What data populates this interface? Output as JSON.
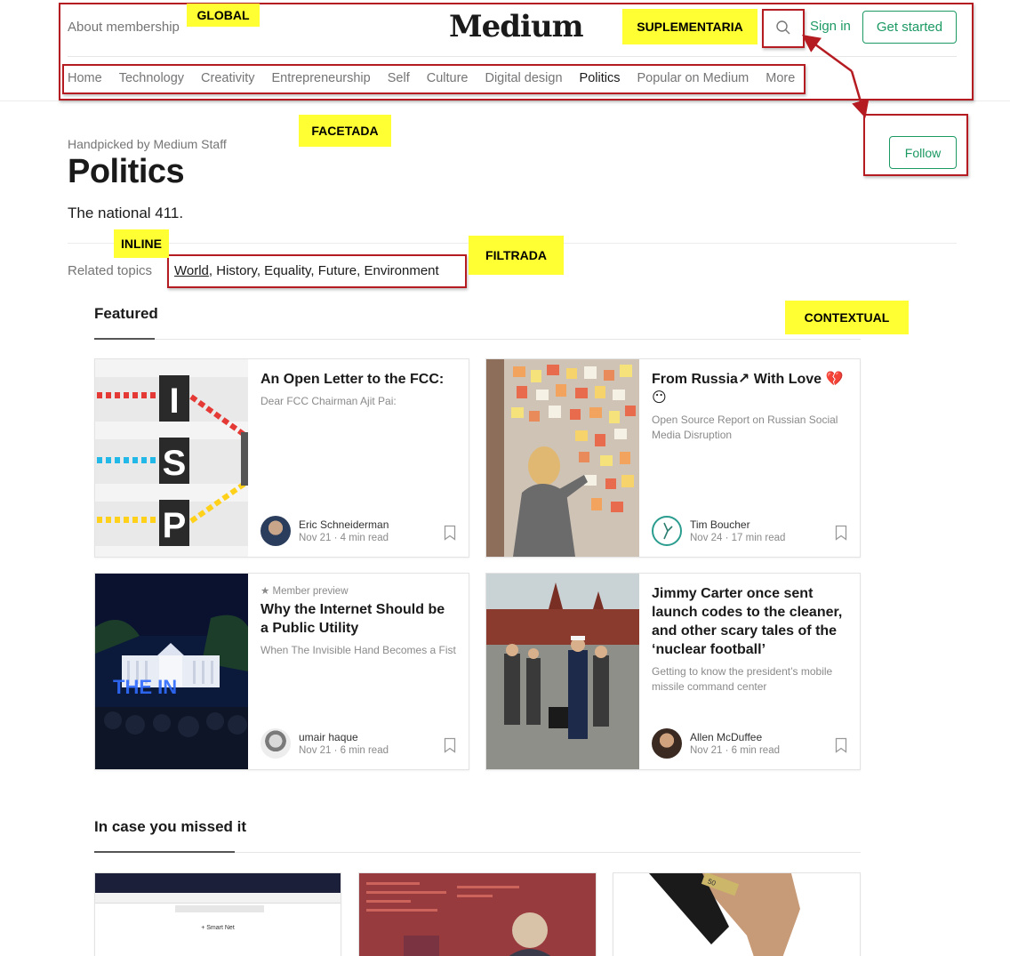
{
  "header": {
    "membership_link": "About membership",
    "logo": "Medium",
    "sign_in": "Sign in",
    "get_started": "Get started"
  },
  "nav": {
    "items": [
      "Home",
      "Technology",
      "Creativity",
      "Entrepreneurship",
      "Self",
      "Culture",
      "Digital design",
      "Politics",
      "Popular on Medium",
      "More"
    ],
    "active": "Politics"
  },
  "topic": {
    "handpicked": "Handpicked by Medium Staff",
    "title": "Politics",
    "description": "The national 411.",
    "follow": "Follow",
    "related_label": "Related topics",
    "related": [
      "World",
      "History",
      "Equality",
      "Future",
      "Environment"
    ]
  },
  "featured": {
    "heading": "Featured",
    "cards": [
      {
        "title": "An Open Letter to the FCC:",
        "subtitle": "Dear FCC Chairman Ajit Pai:",
        "author": "Eric Schneiderman",
        "meta": "Nov 21 · 4 min read",
        "image": "isp-graphic"
      },
      {
        "title": "From Russia↗ With Love 💔😶",
        "subtitle": "Open Source Report on Russian Social Media Disruption",
        "author": "Tim Boucher",
        "meta": "Nov 24 · 17 min read",
        "image": "sticky-notes-wall"
      },
      {
        "member": "★ Member preview",
        "title": "Why the Internet Should be a Public Utility",
        "subtitle": "When The Invisible Hand Becomes a Fist",
        "author": "umair haque",
        "meta": "Nov 21 · 6 min read",
        "image": "white-house-night"
      },
      {
        "title": "Jimmy Carter once sent launch codes to the cleaner, and other scary tales of the ‘nuclear football’",
        "subtitle": "Getting to know the president’s mobile missile command center",
        "author": "Allen McDuffee",
        "meta": "Nov 21 · 6 min read",
        "image": "red-square-officers"
      }
    ]
  },
  "missed": {
    "heading": "In case you missed it",
    "thumb1_text": "+ Smart Net"
  },
  "annotations": {
    "global": "GLOBAL",
    "suplementaria": "SUPLEMENTARIA",
    "facetada": "FACETADA",
    "inline": "INLINE",
    "filtrada": "FILTRADA",
    "contextual": "CONTEXTUAL"
  },
  "colors": {
    "brand_green": "#1c9963",
    "annotation_red": "#b51c22",
    "annotation_yellow": "#ffff33"
  }
}
